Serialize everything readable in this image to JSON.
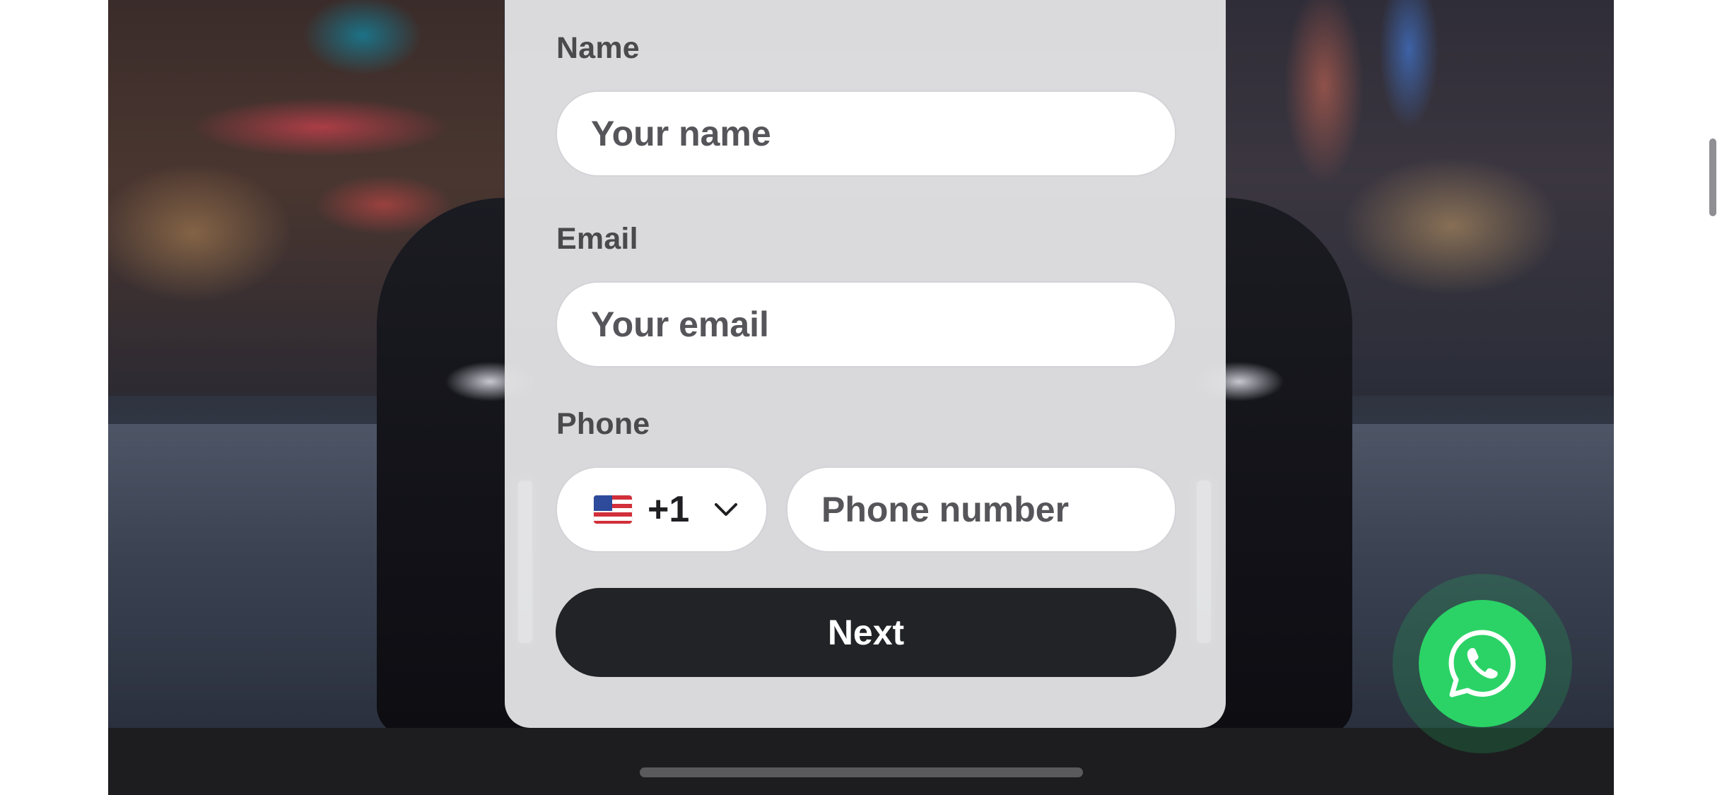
{
  "form": {
    "name_label": "Name",
    "name_placeholder": "Your name",
    "email_label": "Email",
    "email_placeholder": "Your email",
    "phone_label": "Phone",
    "country_code": "+1",
    "country_flag": "us-flag-icon",
    "phone_placeholder": "Phone number",
    "next_label": "Next"
  },
  "whatsapp": {
    "icon": "whatsapp-icon",
    "color": "#2bd366"
  },
  "colors": {
    "button_dark": "#222327",
    "card_bg": "#e2e2e4"
  }
}
